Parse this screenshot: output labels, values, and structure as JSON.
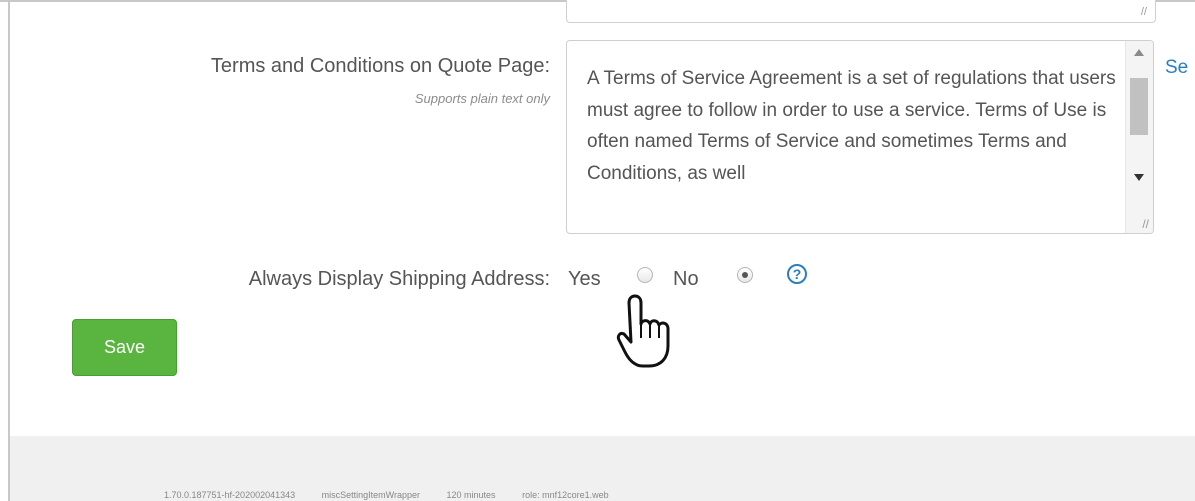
{
  "form": {
    "terms_label": "Terms and Conditions on Quote Page:",
    "terms_hint": "Supports plain text only",
    "terms_value": "A Terms of Service Agreement is a set of regulations that users must agree to follow in order to use a service. Terms of Use is often named Terms of Service and sometimes Terms and Conditions, as well",
    "side_link": "Se",
    "shipping_label": "Always Display Shipping Address:",
    "shipping_yes_label": "Yes",
    "shipping_no_label": "No",
    "shipping_selected": "No",
    "help_symbol": "?",
    "save_label": "Save"
  },
  "footer": {
    "build": "1.70.0.187751-hf-202002041343",
    "wrapper": "miscSettingItemWrapper",
    "timeout": "120 minutes",
    "role": "role: mnf12core1.web"
  },
  "colors": {
    "save_button": "#5ab540",
    "link": "#2a7fc0",
    "footer_bg": "#f0f0f0"
  },
  "icons": [
    "help-icon",
    "pointer-hand-icon",
    "scroll-up-icon",
    "scroll-down-icon",
    "resize-grip-icon"
  ]
}
